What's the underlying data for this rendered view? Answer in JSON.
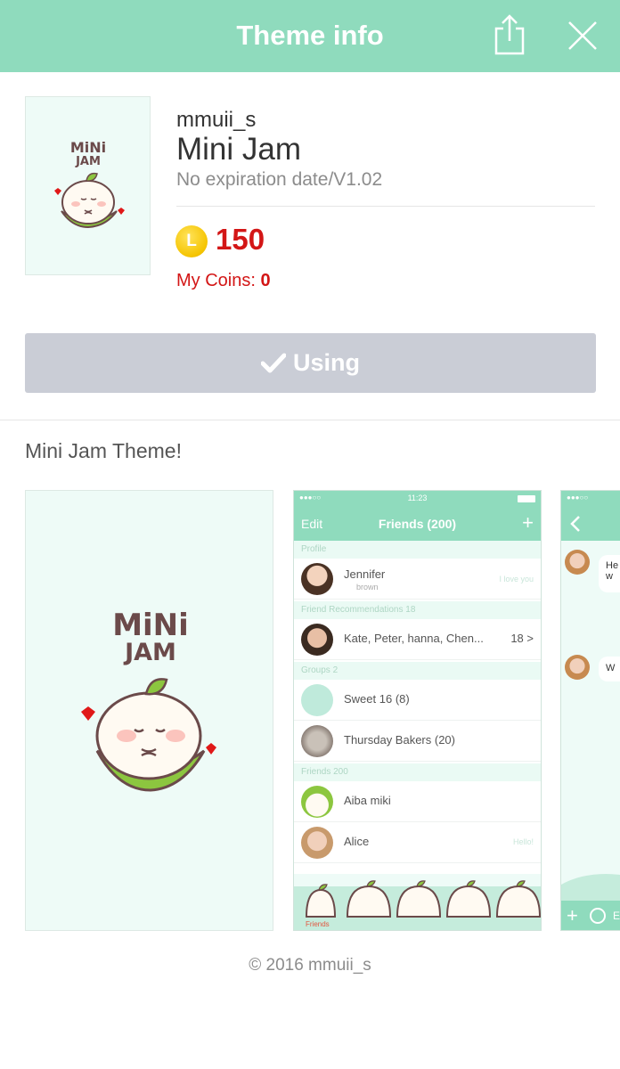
{
  "header": {
    "title": "Theme info",
    "icons": [
      "share-icon",
      "close-icon"
    ],
    "background_color": "#8fdbbd"
  },
  "theme": {
    "author": "mmuii_s",
    "name": "Mini Jam",
    "expiry_version": "No expiration date/V1.02",
    "coin_symbol": "L",
    "price": "150",
    "my_coins_label": "My Coins: ",
    "my_coins_value": "0",
    "logo_line_1": "MiNi",
    "logo_line_2": "JAM",
    "price_color": "#d31616"
  },
  "action": {
    "using_label": "Using",
    "button_color": "#cacdd6"
  },
  "description": "Mini Jam Theme!",
  "preview_friends": {
    "status_time": "11:23",
    "nav_left": "Edit",
    "nav_title": "Friends (200)",
    "nav_right": "+",
    "section_profile": "Profile",
    "profile_name": "Jennifer",
    "profile_id": "brown",
    "profile_status": "I love you",
    "section_recommend": "Friend Recommendations 18",
    "recommend_names": "Kate, Peter, hanna, Chen...",
    "recommend_count": "18 >",
    "section_groups": "Groups 2",
    "group_1": "Sweet 16 (8)",
    "group_2": "Thursday Bakers (20)",
    "section_friends": "Friends 200",
    "friend_1": "Aiba miki",
    "friend_2": "Alice",
    "friend_2_status": "Hello!",
    "tab_label": "Friends"
  },
  "preview_chat": {
    "bubble_1": "He\nw",
    "bubble_2": "W",
    "input_hint": "E"
  },
  "footer": {
    "copyright": "© 2016 mmuii_s"
  }
}
